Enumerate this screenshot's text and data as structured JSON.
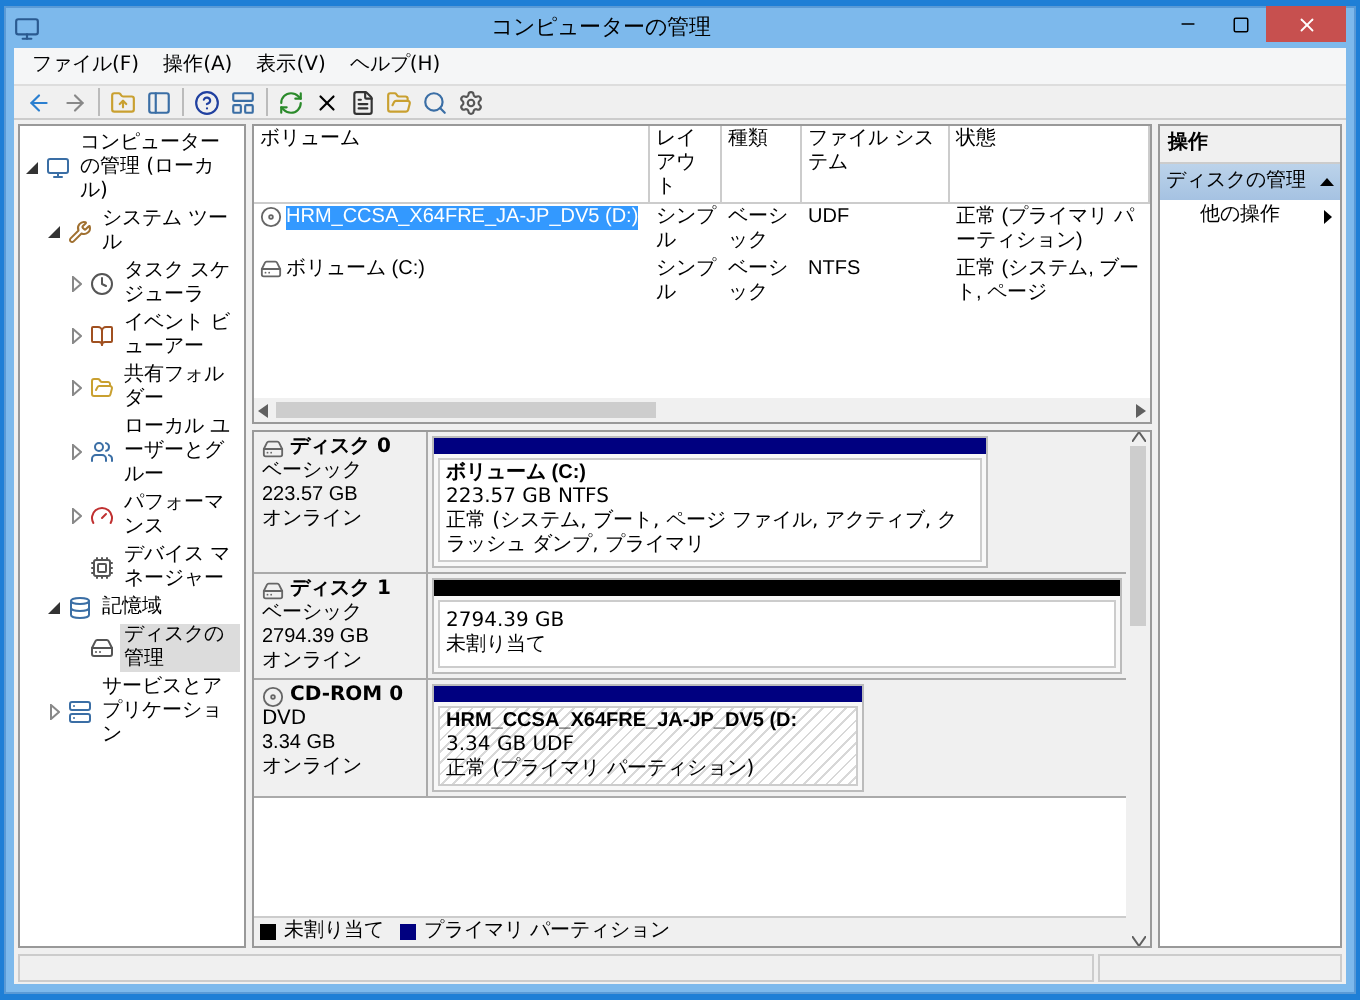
{
  "window": {
    "title": "コンピューターの管理"
  },
  "menu": [
    "ファイル(F)",
    "操作(A)",
    "表示(V)",
    "ヘルプ(H)"
  ],
  "tree": [
    {
      "kind": "computer",
      "label": "コンピューターの管理 (ローカル)",
      "expanded": true,
      "selected": false,
      "children": [
        {
          "kind": "tools",
          "label": "システム ツール",
          "expanded": true,
          "selected": false,
          "children": [
            {
              "kind": "clock",
              "label": "タスク スケジューラ",
              "expanded": false,
              "selected": false
            },
            {
              "kind": "event",
              "label": "イベント ビューアー",
              "expanded": false,
              "selected": false
            },
            {
              "kind": "share",
              "label": "共有フォルダー",
              "expanded": false,
              "selected": false
            },
            {
              "kind": "users",
              "label": "ローカル ユーザーとグルー",
              "expanded": false,
              "selected": false
            },
            {
              "kind": "perf",
              "label": "パフォーマンス",
              "expanded": false,
              "selected": false
            },
            {
              "kind": "device",
              "label": "デバイス マネージャー",
              "selected": false
            }
          ]
        },
        {
          "kind": "storage",
          "label": "記憶域",
          "expanded": true,
          "selected": false,
          "children": [
            {
              "kind": "diskmgmt",
              "label": "ディスクの管理",
              "selected": true
            }
          ]
        },
        {
          "kind": "services",
          "label": "サービスとアプリケーション",
          "expanded": false,
          "selected": false
        }
      ]
    }
  ],
  "volumes": {
    "columns": [
      "ボリューム",
      "レイアウト",
      "種類",
      "ファイル システム",
      "状態"
    ],
    "rows": [
      {
        "kind": "cdrom",
        "selected": true,
        "cells": [
          "HRM_CCSA_X64FRE_JA-JP_DV5 (D:)",
          "シンプル",
          "ベーシック",
          "UDF",
          "正常 (プライマリ パーティション)"
        ]
      },
      {
        "kind": "hdd",
        "selected": false,
        "cells": [
          "ボリューム (C:)",
          "シンプル",
          "ベーシック",
          "NTFS",
          "正常 (システム, ブート, ページ"
        ]
      }
    ]
  },
  "disks": [
    {
      "kind": "hdd",
      "name": "ディスク 0",
      "type": "ベーシック",
      "size": "223.57 GB",
      "status": "オンライン",
      "partitions": [
        {
          "kind": "primary",
          "selected": false,
          "title": "ボリューム (C:)",
          "lines": [
            "223.57 GB NTFS",
            "正常 (システム, ブート, ページ ファイル, アクティブ, クラッシュ ダンプ, プライマリ"
          ]
        }
      ]
    },
    {
      "kind": "hdd",
      "name": "ディスク 1",
      "type": "ベーシック",
      "size": "2794.39 GB",
      "status": "オンライン",
      "partitions": [
        {
          "kind": "unallocated",
          "selected": false,
          "lines": [
            "2794.39 GB",
            "未割り当て"
          ]
        }
      ]
    },
    {
      "kind": "cdrom",
      "name": "CD-ROM 0",
      "type": "DVD",
      "size": "3.34 GB",
      "status": "オンライン",
      "partitions": [
        {
          "kind": "primary",
          "selected": true,
          "title": "HRM_CCSA_X64FRE_JA-JP_DV5  (D:",
          "lines": [
            "3.34 GB UDF",
            "正常 (プライマリ パーティション)"
          ]
        }
      ]
    }
  ],
  "legend": [
    {
      "label": "未割り当て",
      "color": "#000000"
    },
    {
      "label": "プライマリ パーティション",
      "color": "#000080"
    }
  ],
  "actions": {
    "header": "操作",
    "section": {
      "title": "ディスクの管理",
      "expanded": true
    },
    "items": [
      "他の操作"
    ]
  }
}
